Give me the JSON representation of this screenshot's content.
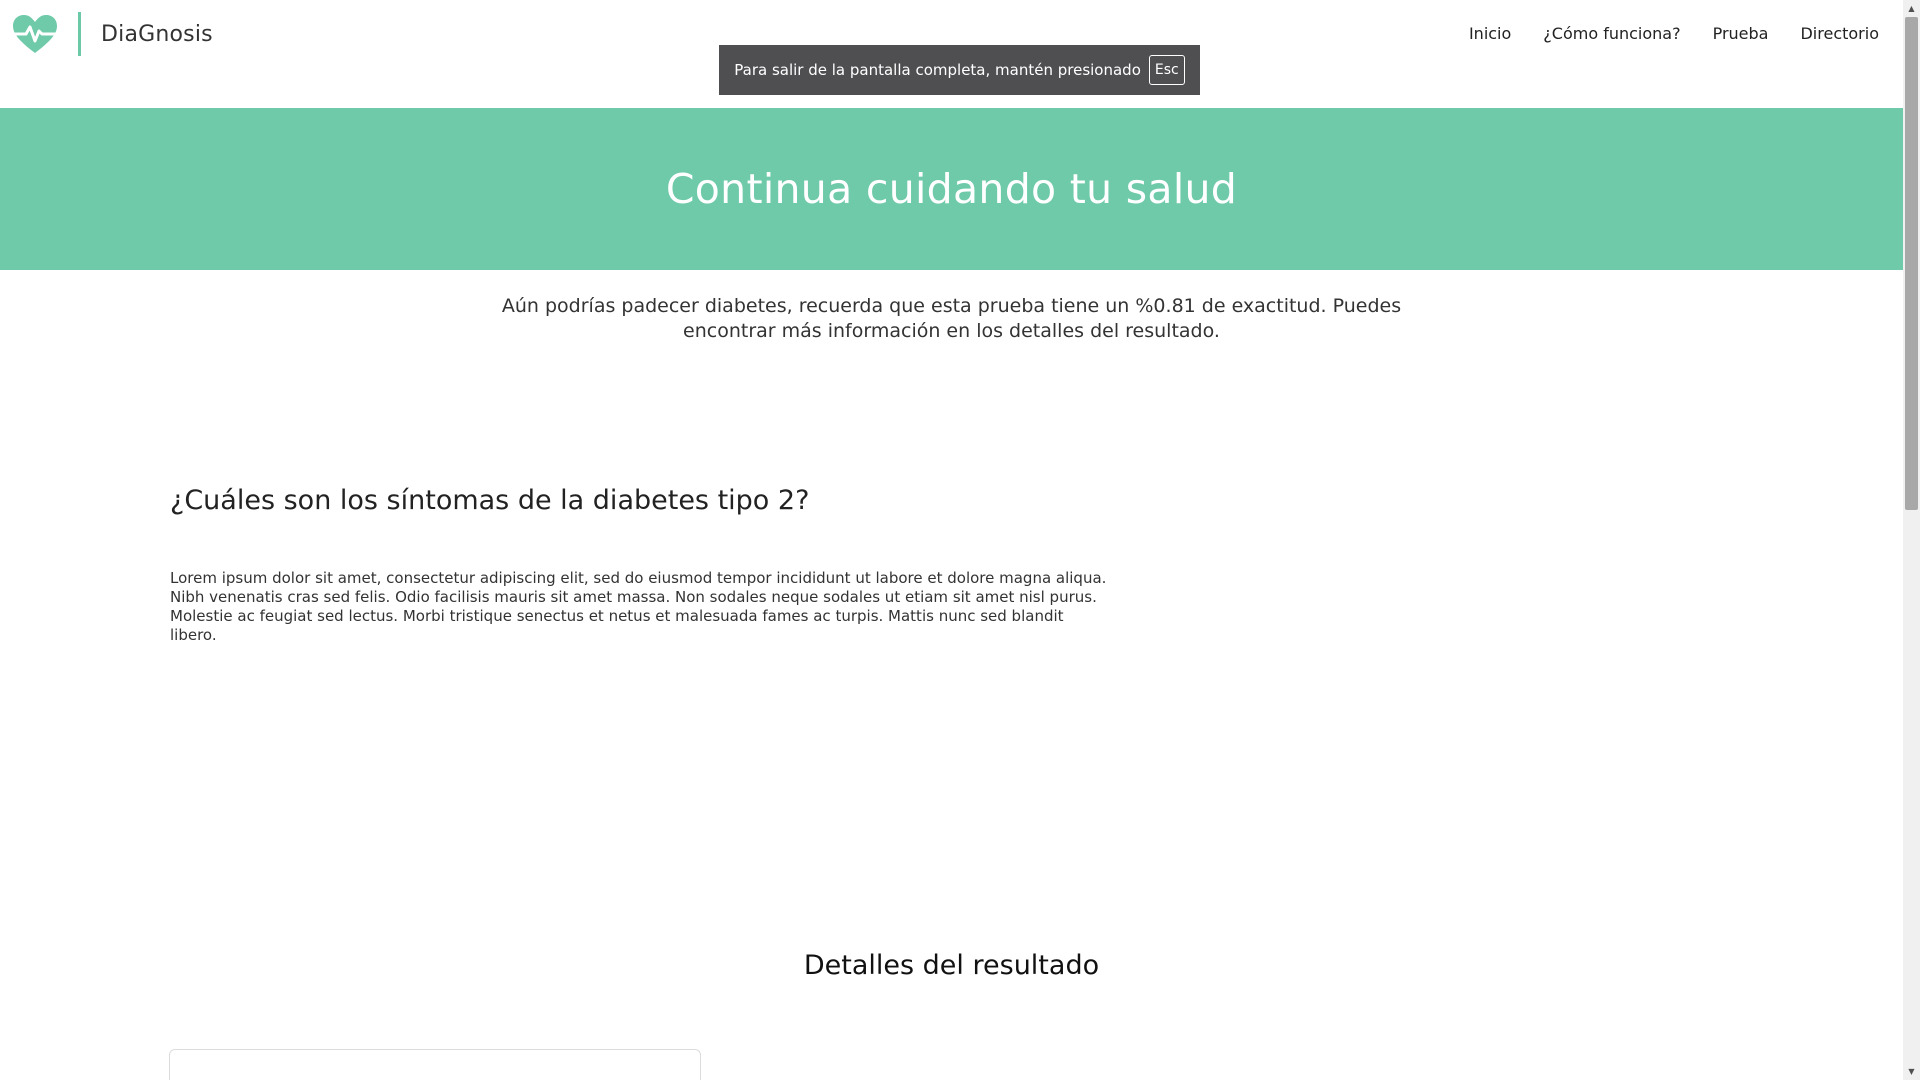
{
  "brand": {
    "name": "DiaGnosis",
    "accent_color": "#6ecaa9",
    "logo_icon": "heart-pulse-icon"
  },
  "nav": {
    "items": [
      {
        "label": "Inicio"
      },
      {
        "label": "¿Cómo funciona?"
      },
      {
        "label": "Prueba"
      },
      {
        "label": "Directorio"
      }
    ]
  },
  "fullscreen_notice": {
    "text": "Para salir de la pantalla completa, mantén presionado",
    "key": "Esc"
  },
  "hero": {
    "title": "Continua cuidando tu salud"
  },
  "result": {
    "message": "Aún podrías padecer diabetes, recuerda que esta prueba tiene un %0.81 de exactitud. Puedes encontrar más información en los detalles del resultado."
  },
  "symptoms": {
    "title": "¿Cuáles son los síntomas de la diabetes tipo 2?",
    "body": "Lorem ipsum dolor sit amet, consectetur adipiscing elit, sed do eiusmod tempor incididunt ut labore et dolore magna aliqua. Nibh venenatis cras sed felis. Odio facilisis mauris sit amet massa. Non sodales neque sodales ut etiam sit amet nisl purus. Molestie ac feugiat sed lectus. Morbi tristique senectus et netus et malesuada fames ac turpis. Mattis nunc sed blandit libero."
  },
  "details": {
    "title": "Detalles del resultado"
  }
}
